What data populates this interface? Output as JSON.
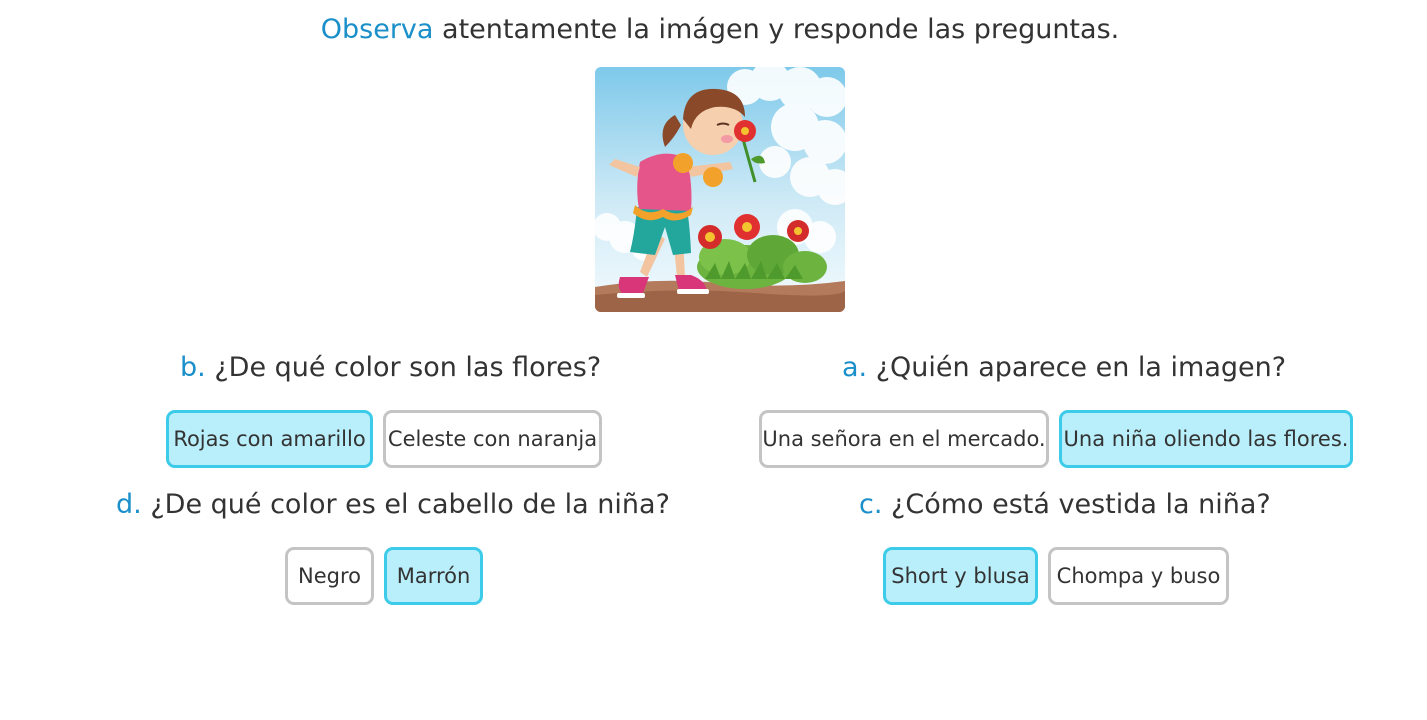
{
  "instruction": {
    "highlight": "Observa",
    "rest": " atentamente la imágen y responde las preguntas."
  },
  "questions": [
    {
      "letter": "b.",
      "text": " ¿De qué color son las flores?",
      "options": [
        {
          "label": "Rojas con amarillo",
          "selected": true
        },
        {
          "label": "Celeste con naranja",
          "selected": false
        }
      ]
    },
    {
      "letter": "a.",
      "text": " ¿Quién aparece en la imagen?",
      "options": [
        {
          "label": "Una señora en el mercado.",
          "selected": false
        },
        {
          "label": "Una niña oliendo las flores.",
          "selected": true
        }
      ]
    },
    {
      "letter": "d.",
      "text": " ¿De qué color es el cabello de la niña?",
      "options": [
        {
          "label": "Negro",
          "selected": false
        },
        {
          "label": "Marrón",
          "selected": true
        }
      ]
    },
    {
      "letter": "c.",
      "text": " ¿Cómo está vestida la niña?",
      "options": [
        {
          "label": "Short y blusa",
          "selected": true
        },
        {
          "label": "Chompa y buso",
          "selected": false
        }
      ]
    }
  ],
  "colors": {
    "accent": "#1a8fc9",
    "selected_bg": "#b9eefb",
    "selected_border": "#3ccbe8",
    "unselected_border": "#c4c4c4"
  },
  "illustration": {
    "icon": "girl-smelling-flowers-illustration"
  }
}
